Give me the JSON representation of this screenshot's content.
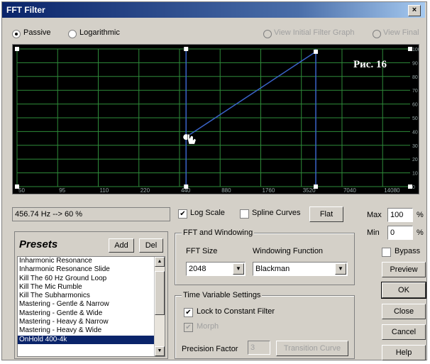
{
  "window": {
    "title": "FFT Filter",
    "close_glyph": "×"
  },
  "mode": {
    "passive": "Passive",
    "logarithmic": "Logarithmic",
    "view_initial": "View Initial Filter Graph",
    "view_final": "View Final"
  },
  "graph": {
    "annotation": "Рис. 16",
    "x_ticks": [
      "50",
      "95",
      "110",
      "220",
      "440",
      "880",
      "1760",
      "3520",
      "7040",
      "14080"
    ],
    "y_ticks": [
      "0",
      "10",
      "20",
      "30",
      "40",
      "50",
      "60",
      "70",
      "80",
      "90",
      "100"
    ],
    "grid_color": "#2e8b3a",
    "line_color": "#3a63c8"
  },
  "status": {
    "readout": "456.74 Hz --> 60 %"
  },
  "options": {
    "log_scale": "Log Scale",
    "spline_curves": "Spline Curves",
    "flat": "Flat"
  },
  "range": {
    "max_label": "Max",
    "max_value": "100",
    "min_label": "Min",
    "min_value": "0",
    "unit": "%"
  },
  "presets": {
    "title": "Presets",
    "add": "Add",
    "del": "Del",
    "items": [
      "Inharmonic Resonance",
      "Inharmonic Resonance Slide",
      "Kill The 60 Hz Ground Loop",
      "Kill The Mic Rumble",
      "Kill The Subharmonics",
      "Mastering - Gentle & Narrow",
      "Mastering - Gentle & Wide",
      "Mastering - Heavy & Narrow",
      "Mastering - Heavy & Wide",
      "OnHold 400-4k"
    ],
    "selected_index": 9
  },
  "fft": {
    "group_title": "FFT and Windowing",
    "size_label": "FFT Size",
    "size_value": "2048",
    "window_label": "Windowing Function",
    "window_value": "Blackman"
  },
  "timevar": {
    "group_title": "Time Variable Settings",
    "lock": "Lock to Constant Filter",
    "morph": "Morph",
    "precision_label": "Precision Factor",
    "precision_value": "3",
    "transition": "Transition Curve"
  },
  "side": {
    "bypass": "Bypass",
    "preview": "Preview",
    "ok": "OK",
    "close": "Close",
    "cancel": "Cancel",
    "help": "Help"
  }
}
